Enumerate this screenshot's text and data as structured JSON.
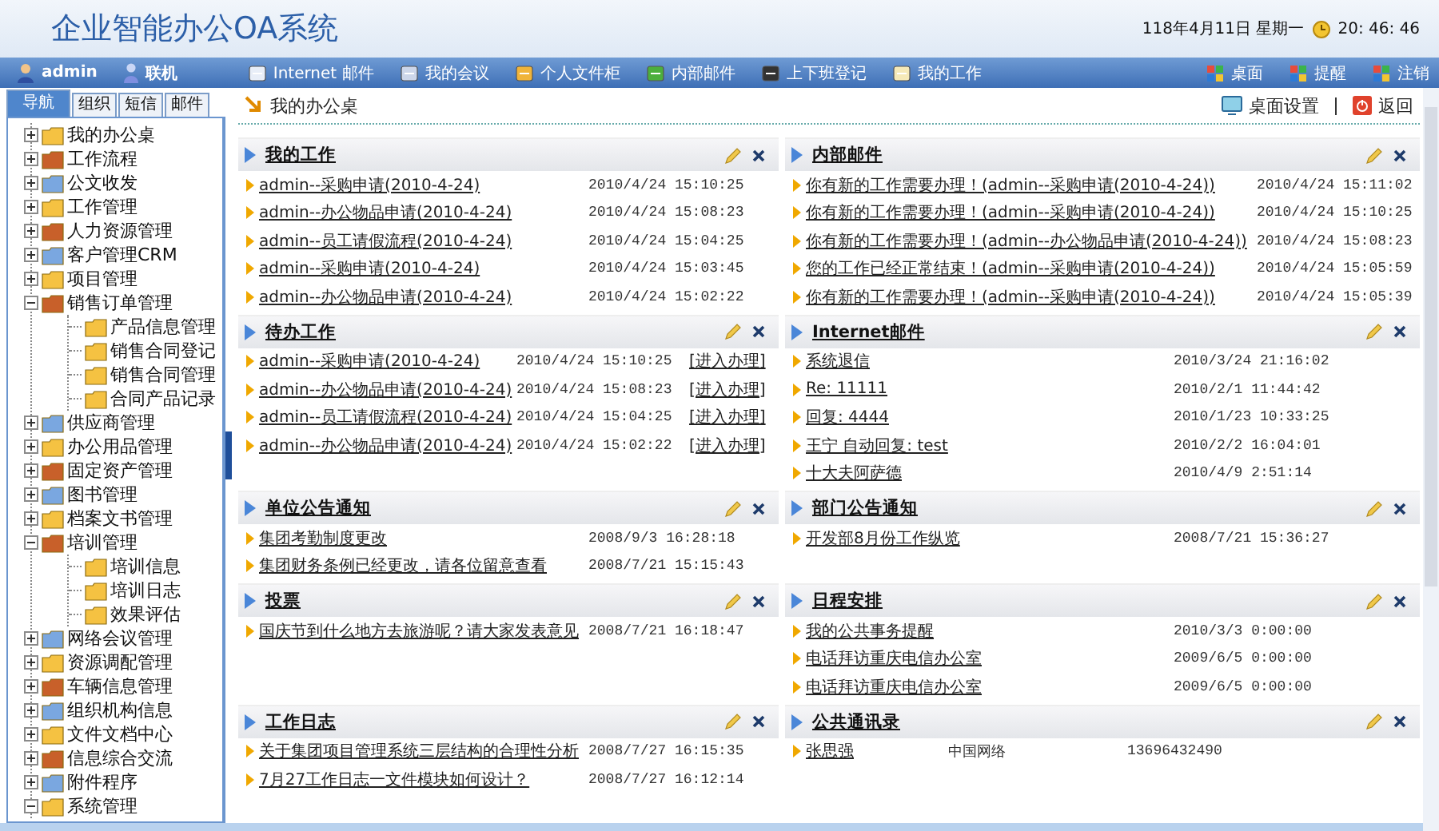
{
  "header": {
    "title": "企业智能办公OA系统",
    "date": "118年4月11日 星期一",
    "time": "20: 46: 46"
  },
  "nav": {
    "user": "admin",
    "status": "联机",
    "items": [
      {
        "label": "Internet 邮件"
      },
      {
        "label": "我的会议"
      },
      {
        "label": "个人文件柜"
      },
      {
        "label": "内部邮件"
      },
      {
        "label": "上下班登记"
      },
      {
        "label": "我的工作"
      }
    ],
    "right_items": [
      {
        "label": "桌面"
      },
      {
        "label": "提醒"
      },
      {
        "label": "注销"
      }
    ]
  },
  "sidebar": {
    "tabs": [
      {
        "label": "导航",
        "selected": true
      },
      {
        "label": "组织",
        "selected": false
      },
      {
        "label": "短信",
        "selected": false
      },
      {
        "label": "邮件",
        "selected": false
      }
    ],
    "tree": [
      {
        "label": "我的办公桌",
        "expanded": false
      },
      {
        "label": "工作流程",
        "expanded": false
      },
      {
        "label": "公文收发",
        "expanded": false
      },
      {
        "label": "工作管理",
        "expanded": false
      },
      {
        "label": "人力资源管理",
        "expanded": false
      },
      {
        "label": "客户管理CRM",
        "expanded": false
      },
      {
        "label": "项目管理",
        "expanded": false
      },
      {
        "label": "销售订单管理",
        "expanded": true,
        "children": [
          {
            "label": "产品信息管理"
          },
          {
            "label": "销售合同登记"
          },
          {
            "label": "销售合同管理"
          },
          {
            "label": "合同产品记录"
          }
        ]
      },
      {
        "label": "供应商管理",
        "expanded": false
      },
      {
        "label": "办公用品管理",
        "expanded": false
      },
      {
        "label": "固定资产管理",
        "expanded": false
      },
      {
        "label": "图书管理",
        "expanded": false
      },
      {
        "label": "档案文书管理",
        "expanded": false
      },
      {
        "label": "培训管理",
        "expanded": true,
        "children": [
          {
            "label": "培训信息"
          },
          {
            "label": "培训日志"
          },
          {
            "label": "效果评估"
          }
        ]
      },
      {
        "label": "网络会议管理",
        "expanded": false
      },
      {
        "label": "资源调配管理",
        "expanded": false
      },
      {
        "label": "车辆信息管理",
        "expanded": false
      },
      {
        "label": "组织机构信息",
        "expanded": false
      },
      {
        "label": "文件文档中心",
        "expanded": false
      },
      {
        "label": "信息综合交流",
        "expanded": false
      },
      {
        "label": "附件程序",
        "expanded": false
      },
      {
        "label": "系统管理",
        "expanded": true
      }
    ]
  },
  "breadcrumb": {
    "label": "我的办公桌",
    "settings": "桌面设置",
    "back": "返回"
  },
  "panels": [
    {
      "title": "我的工作",
      "kind": "list",
      "rows": [
        {
          "link": "admin--采购申请(2010-4-24)",
          "info": [
            "2010/4/24 15:10:25"
          ]
        },
        {
          "link": "admin--办公物品申请(2010-4-24)",
          "info": [
            "2010/4/24 15:08:23"
          ]
        },
        {
          "link": "admin--员工请假流程(2010-4-24)",
          "info": [
            "2010/4/24 15:04:25"
          ]
        },
        {
          "link": "admin--采购申请(2010-4-24)",
          "info": [
            "2010/4/24 15:03:45"
          ]
        },
        {
          "link": "admin--办公物品申请(2010-4-24)",
          "info": [
            "2010/4/24 15:02:22"
          ]
        }
      ]
    },
    {
      "title": "内部邮件",
      "kind": "mail",
      "rows": [
        {
          "link": "你有新的工作需要办理！(admin--采购申请(2010-4-24))",
          "info": [
            "2010/4/24 15:11:02"
          ]
        },
        {
          "link": "你有新的工作需要办理！(admin--采购申请(2010-4-24))",
          "info": [
            "2010/4/24 15:10:25"
          ]
        },
        {
          "link": "你有新的工作需要办理！(admin--办公物品申请(2010-4-24))",
          "info": [
            "2010/4/24 15:08:23"
          ]
        },
        {
          "link": "您的工作已经正常结束！(admin--采购申请(2010-4-24))",
          "info": [
            "2010/4/24 15:05:59"
          ]
        },
        {
          "link": "你有新的工作需要办理！(admin--采购申请(2010-4-24))",
          "info": [
            "2010/4/24 15:05:39"
          ]
        }
      ]
    },
    {
      "title": "待办工作",
      "kind": "tasks",
      "rows": [
        {
          "link": "admin--采购申请(2010-4-24)",
          "info": [
            "2010/4/24 15:10:25"
          ],
          "action": "[进入办理]"
        },
        {
          "link": "admin--办公物品申请(2010-4-24)",
          "info": [
            "2010/4/24 15:08:23"
          ],
          "action": "[进入办理]"
        },
        {
          "link": "admin--员工请假流程(2010-4-24)",
          "info": [
            "2010/4/24 15:04:25"
          ],
          "action": "[进入办理]"
        },
        {
          "link": "admin--办公物品申请(2010-4-24)",
          "info": [
            "2010/4/24 15:02:22"
          ],
          "action": "[进入办理]"
        }
      ]
    },
    {
      "title": "Internet邮件",
      "kind": "brief",
      "rows": [
        {
          "link": "系统退信",
          "info": [
            "2010/3/24 21:16:02"
          ]
        },
        {
          "link": "Re: 11111",
          "info": [
            "2010/2/1 11:44:42"
          ]
        },
        {
          "link": "回复: 4444",
          "info": [
            "2010/1/23 10:33:25"
          ]
        },
        {
          "link": "王宁 自动回复: test",
          "info": [
            "2010/2/2 16:04:01"
          ]
        },
        {
          "link": "十大夫阿萨德",
          "info": [
            "2010/4/9 2:51:14"
          ]
        }
      ]
    },
    {
      "title": "单位公告通知",
      "kind": "list",
      "rows": [
        {
          "link": "集团考勤制度更改",
          "info": [
            "2008/9/3 16:28:18"
          ]
        },
        {
          "link": "集团财务条例已经更改，请各位留意查看",
          "info": [
            "2008/7/21 15:15:43"
          ]
        }
      ]
    },
    {
      "title": "部门公告通知",
      "kind": "brief",
      "rows": [
        {
          "link": "开发部8月份工作纵览",
          "info": [
            "2008/7/21 15:36:27"
          ]
        }
      ]
    },
    {
      "title": "投票",
      "kind": "list",
      "rows": [
        {
          "link": "国庆节到什么地方去旅游呢？请大家发表意见",
          "info": [
            "2008/7/21 16:18:47"
          ]
        }
      ]
    },
    {
      "title": "日程安排",
      "kind": "brief",
      "rows": [
        {
          "link": "我的公共事务提醒",
          "info": [
            "2010/3/3 0:00:00"
          ]
        },
        {
          "link": "电话拜访重庆电信办公室",
          "info": [
            "2009/6/5 0:00:00"
          ]
        },
        {
          "link": "电话拜访重庆电信办公室",
          "info": [
            "2009/6/5 0:00:00"
          ]
        }
      ]
    },
    {
      "title": "工作日志",
      "kind": "list",
      "rows": [
        {
          "link": "关于集团项目管理系统三层结构的合理性分析",
          "info": [
            "2008/7/27 16:15:35"
          ]
        },
        {
          "link": "7月27工作日志一文件模块如何设计？",
          "info": [
            "2008/7/27 16:12:14"
          ]
        }
      ]
    },
    {
      "title": "公共通讯录",
      "kind": "contacts",
      "rows": [
        {
          "link": "张思强",
          "info": [
            "中国网络",
            "13696432490"
          ]
        }
      ]
    }
  ]
}
